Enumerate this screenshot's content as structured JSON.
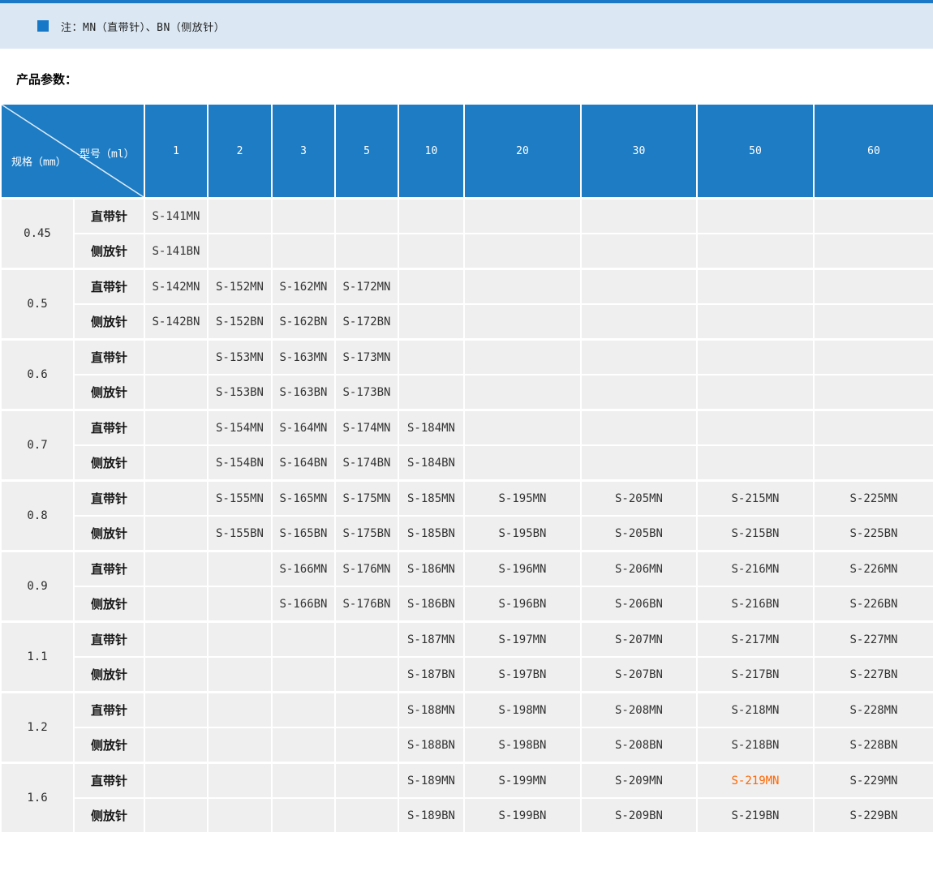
{
  "note_banner": {
    "icon": "blue-square-bullet-icon",
    "text": "注：MN（直带针）、BN（侧放针）"
  },
  "section_title": "产品参数：",
  "table": {
    "corner": {
      "row_axis_label": "规格（mm）",
      "col_axis_label": "型号（ml）"
    },
    "columns": [
      "1",
      "2",
      "3",
      "5",
      "10",
      "20",
      "30",
      "50",
      "60"
    ],
    "needle_types": {
      "mn": "直带针",
      "bn": "侧放针"
    },
    "groups": [
      {
        "spec": "0.45",
        "mn": [
          "S-141MN",
          "",
          "",
          "",
          "",
          "",
          "",
          "",
          ""
        ],
        "bn": [
          "S-141BN",
          "",
          "",
          "",
          "",
          "",
          "",
          "",
          ""
        ]
      },
      {
        "spec": "0.5",
        "mn": [
          "S-142MN",
          "S-152MN",
          "S-162MN",
          "S-172MN",
          "",
          "",
          "",
          "",
          ""
        ],
        "bn": [
          "S-142BN",
          "S-152BN",
          "S-162BN",
          "S-172BN",
          "",
          "",
          "",
          "",
          ""
        ]
      },
      {
        "spec": "0.6",
        "mn": [
          "",
          "S-153MN",
          "S-163MN",
          "S-173MN",
          "",
          "",
          "",
          "",
          ""
        ],
        "bn": [
          "",
          "S-153BN",
          "S-163BN",
          "S-173BN",
          "",
          "",
          "",
          "",
          ""
        ]
      },
      {
        "spec": "0.7",
        "mn": [
          "",
          "S-154MN",
          "S-164MN",
          "S-174MN",
          "S-184MN",
          "",
          "",
          "",
          ""
        ],
        "bn": [
          "",
          "S-154BN",
          "S-164BN",
          "S-174BN",
          "S-184BN",
          "",
          "",
          "",
          ""
        ]
      },
      {
        "spec": "0.8",
        "mn": [
          "",
          "S-155MN",
          "S-165MN",
          "S-175MN",
          "S-185MN",
          "S-195MN",
          "S-205MN",
          "S-215MN",
          "S-225MN"
        ],
        "bn": [
          "",
          "S-155BN",
          "S-165BN",
          "S-175BN",
          "S-185BN",
          "S-195BN",
          "S-205BN",
          "S-215BN",
          "S-225BN"
        ]
      },
      {
        "spec": "0.9",
        "mn": [
          "",
          "",
          "S-166MN",
          "S-176MN",
          "S-186MN",
          "S-196MN",
          "S-206MN",
          "S-216MN",
          "S-226MN"
        ],
        "bn": [
          "",
          "",
          "S-166BN",
          "S-176BN",
          "S-186BN",
          "S-196BN",
          "S-206BN",
          "S-216BN",
          "S-226BN"
        ]
      },
      {
        "spec": "1.1",
        "mn": [
          "",
          "",
          "",
          "",
          "S-187MN",
          "S-197MN",
          "S-207MN",
          "S-217MN",
          "S-227MN"
        ],
        "bn": [
          "",
          "",
          "",
          "",
          "S-187BN",
          "S-197BN",
          "S-207BN",
          "S-217BN",
          "S-227BN"
        ]
      },
      {
        "spec": "1.2",
        "mn": [
          "",
          "",
          "",
          "",
          "S-188MN",
          "S-198MN",
          "S-208MN",
          "S-218MN",
          "S-228MN"
        ],
        "bn": [
          "",
          "",
          "",
          "",
          "S-188BN",
          "S-198BN",
          "S-208BN",
          "S-218BN",
          "S-228BN"
        ]
      },
      {
        "spec": "1.6",
        "mn": [
          "",
          "",
          "",
          "",
          "S-189MN",
          "S-199MN",
          "S-209MN",
          "S-219MN",
          "S-229MN"
        ],
        "bn": [
          "",
          "",
          "",
          "",
          "S-189BN",
          "S-199BN",
          "S-209BN",
          "S-219BN",
          "S-229BN"
        ]
      }
    ],
    "highlight": {
      "spec": "1.6",
      "type": "mn",
      "col_index": 7,
      "value": "S-219MN",
      "color": "#ff6600"
    }
  },
  "colors": {
    "top_line_blue": "#1a78c6",
    "banner_bg": "#dbe8f4",
    "bullet_blue": "#1878c8",
    "header_blue": "#1d7cc4",
    "cell_bg": "#efefef",
    "grid_white": "#ffffff",
    "highlight_orange": "#ff6600"
  }
}
